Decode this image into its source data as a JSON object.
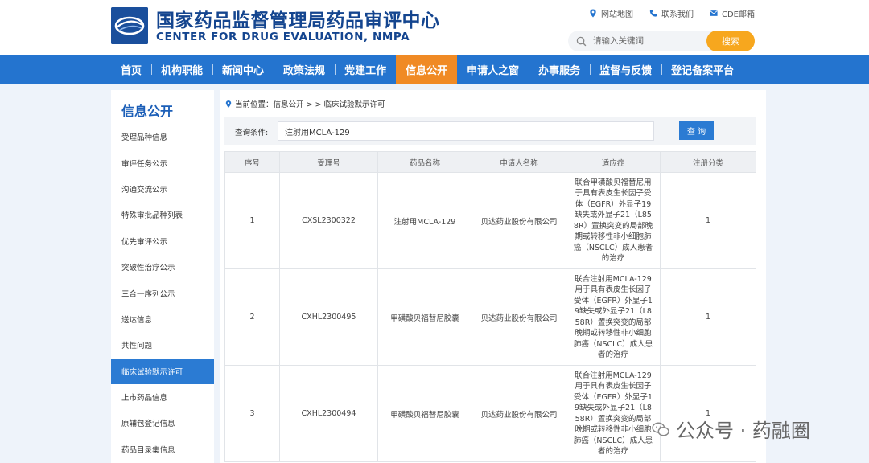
{
  "header": {
    "title_cn": "国家药品监督管理局药品审评中心",
    "title_en": "CENTER FOR DRUG EVALUATION, NMPA",
    "links": [
      {
        "label": "网站地图",
        "icon": "location-pin-icon"
      },
      {
        "label": "联系我们",
        "icon": "phone-icon"
      },
      {
        "label": "CDE邮箱",
        "icon": "mail-icon"
      }
    ],
    "search": {
      "placeholder": "请输入关键词",
      "button": "搜索"
    }
  },
  "nav": {
    "items": [
      "首页",
      "机构职能",
      "新闻中心",
      "政策法规",
      "党建工作",
      "信息公开",
      "申请人之窗",
      "办事服务",
      "监督与反馈",
      "登记备案平台"
    ],
    "active": "信息公开"
  },
  "sidebar": {
    "title": "信息公开",
    "items": [
      "受理品种信息",
      "审评任务公示",
      "沟通交流公示",
      "特殊审批品种列表",
      "优先审评公示",
      "突破性治疗公示",
      "三合一序列公示",
      "送达信息",
      "共性问题",
      "临床试验默示许可",
      "上市药品信息",
      "原辅包登记信息",
      "药品目录集信息"
    ],
    "active": "临床试验默示许可"
  },
  "main": {
    "breadcrumb": "当前位置：信息公开 > > 临床试验默示许可",
    "query": {
      "label": "查询条件:",
      "value": "注射用MCLA-129",
      "button": "查 询"
    },
    "table": {
      "headers": [
        "序号",
        "受理号",
        "药品名称",
        "申请人名称",
        "适应症",
        "注册分类"
      ],
      "rows": [
        [
          "1",
          "CXSL2300322",
          "注射用MCLA-129",
          "贝达药业股份有限公司",
          "联合甲磺酸贝福替尼用于具有表皮生长因子受体（EGFR）外显子19缺失或外显子21（L858R）置换突变的局部晚期或转移性非小细胞肺癌（NSCLC）成人患者的治疗",
          "1"
        ],
        [
          "2",
          "CXHL2300495",
          "甲磺酸贝福替尼胶囊",
          "贝达药业股份有限公司",
          "联合注射用MCLA-129用于具有表皮生长因子受体（EGFR）外显子19缺失或外显子21（L858R）置换突变的局部晚期或转移性非小细胞肺癌（NSCLC）成人患者的治疗",
          "1"
        ],
        [
          "3",
          "CXHL2300494",
          "甲磺酸贝福替尼胶囊",
          "贝达药业股份有限公司",
          "联合注射用MCLA-129用于具有表皮生长因子受体（EGFR）外显子19缺失或外显子21（L858R）置换突变的局部晚期或转移性非小细胞肺癌（NSCLC）成人患者的治疗",
          "1"
        ]
      ]
    }
  },
  "watermark": {
    "text": "公众号 · 药融圈"
  },
  "colors": {
    "brand_blue": "#14458f",
    "nav_blue": "#2474cf",
    "nav_active": "#f08a24",
    "search_orange": "#f7a71e",
    "sidebar_active": "#2b7bd3"
  }
}
